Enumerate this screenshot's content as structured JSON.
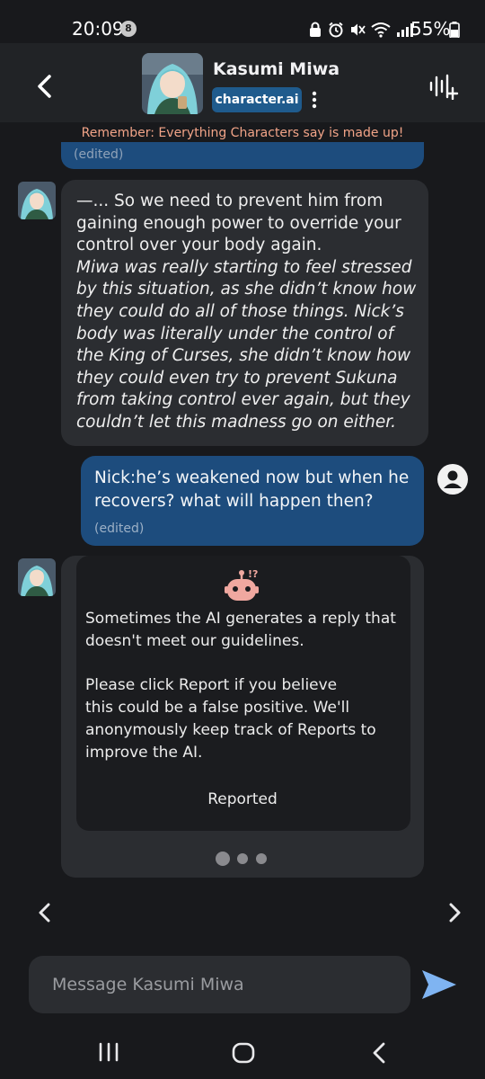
{
  "status_bar": {
    "time": "20:09",
    "notification_count": "8",
    "battery": "55%",
    "icons": [
      "lock-icon",
      "alarm-icon",
      "mute-icon",
      "wifi-icon",
      "signal-icon",
      "battery-icon"
    ]
  },
  "header": {
    "character_name": "Kasumi Miwa",
    "brand": "character.ai",
    "icons": [
      "back-arrow-icon",
      "more-vert-icon",
      "voice-waveform-icon"
    ]
  },
  "warning": "Remember: Everything Characters say is made up!",
  "messages": {
    "previous_edited": "(edited)",
    "bot": {
      "lines_plain": [
        "—... So we need to prevent him from",
        "gaining enough power to override your",
        "control over your body again."
      ],
      "lines_italic": [
        "Miwa was really starting to feel stressed",
        "by this situation, as she didn’t know how",
        "they could do all of those things. Nick’s",
        "body was literally under the control of",
        "the King of Curses, she didn’t know how",
        "they could even try to prevent Sukuna",
        "from taking control ever again, but they",
        "couldn’t let this madness go on either."
      ]
    },
    "user": {
      "lines": [
        "Nick:he’s weakened now but when he",
        "recovers? what will happen then?"
      ],
      "edited": "(edited)"
    },
    "report_card": {
      "p1_lines": [
        "Sometimes the AI generates a reply that",
        "doesn't meet our guidelines."
      ],
      "p2_lines": [
        "Please click Report if you believe",
        "this could be a false positive. We'll",
        "anonymously keep track of Reports to",
        "improve the AI."
      ],
      "button": "Reported"
    }
  },
  "composer": {
    "placeholder": "Message Kasumi Miwa"
  },
  "colors": {
    "background": "#18191c",
    "header": "#212326",
    "bot_bubble": "#2b2d31",
    "user_bubble": "#1d4c7d",
    "brand_pill": "#1f5b8d",
    "warning_text": "#f2a488",
    "send_icon": "#7fb4f2",
    "robot_icon": "#f0a8a0"
  }
}
